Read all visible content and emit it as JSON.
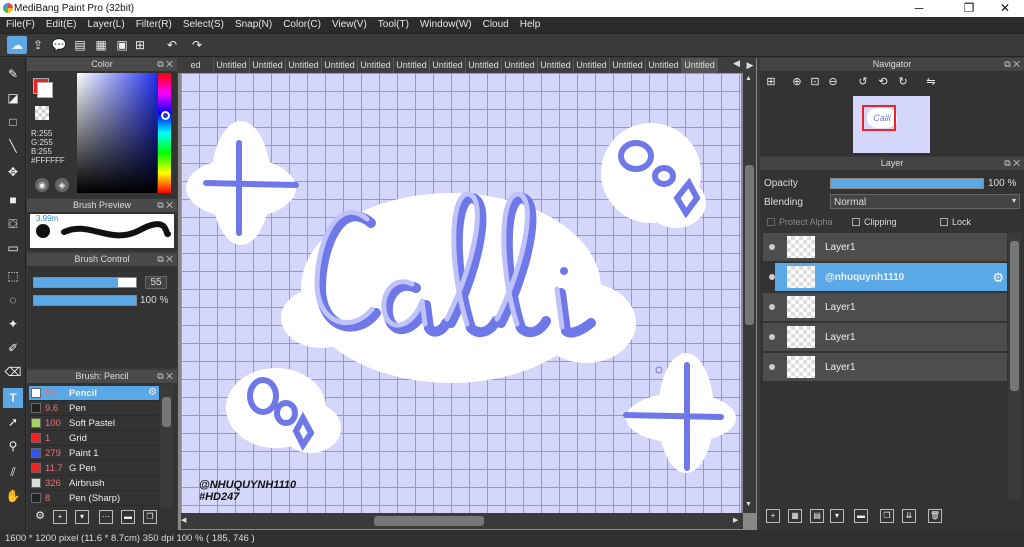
{
  "app": {
    "title": "MediBang Paint Pro (32bit)"
  },
  "window_controls": {
    "minimize": "─",
    "restore": "❐",
    "close": "✕"
  },
  "menu": [
    "File(F)",
    "Edit(E)",
    "Layer(L)",
    "Filter(R)",
    "Select(S)",
    "Snap(N)",
    "Color(C)",
    "View(V)",
    "Tool(T)",
    "Window(W)",
    "Cloud",
    "Help"
  ],
  "color_panel": {
    "title": "Color",
    "r": "R:255",
    "g": "G:255",
    "b": "B:255",
    "hex": "#FFFFFF",
    "primary": "#ffffff",
    "secondary": "#ee2222"
  },
  "brush_preview": {
    "title": "Brush Preview",
    "size": "3.99m"
  },
  "brush_control": {
    "title": "Brush Control",
    "size_value": "55",
    "opacity_value": "100 %",
    "size_fraction": 0.82,
    "opacity_fraction": 1.0
  },
  "brush_list": {
    "title": "Brush: Pencil",
    "items": [
      {
        "size": "55",
        "name": "Pencil",
        "color": "#ffffff",
        "selected": true
      },
      {
        "size": "9.6",
        "name": "Pen",
        "color": "#222222",
        "selected": false
      },
      {
        "size": "100",
        "name": "Soft Pastel",
        "color": "#a4d65e",
        "selected": false
      },
      {
        "size": "1",
        "name": "Grid",
        "color": "#ee2222",
        "selected": false
      },
      {
        "size": "279",
        "name": "Paint 1",
        "color": "#3355ee",
        "selected": false
      },
      {
        "size": "11.7",
        "name": "G Pen",
        "color": "#ee2222",
        "selected": false
      },
      {
        "size": "326",
        "name": "Airbrush",
        "color": "#dddddd",
        "selected": false
      },
      {
        "size": "8",
        "name": "Pen (Sharp)",
        "color": "#222222",
        "selected": false
      }
    ]
  },
  "canvas": {
    "tabs": [
      "ed",
      "Untitled",
      "Untitled",
      "Untitled",
      "Untitled",
      "Untitled",
      "Untitled",
      "Untitled",
      "Untitled",
      "Untitled",
      "Untitled",
      "Untitled",
      "Untitled",
      "Untitled",
      "Untitled"
    ],
    "art_text": "Calli",
    "signature_1": "@NHUQUYNH1110",
    "signature_2": "#HD247"
  },
  "navigator": {
    "title": "Navigator"
  },
  "layer_panel": {
    "title": "Layer",
    "opacity_label": "Opacity",
    "opacity_value": "100 %",
    "opacity_fraction": 1.0,
    "blending_label": "Blending",
    "blending_value": "Normal",
    "protect_alpha": "Protect Alpha",
    "clipping": "Clipping",
    "lock": "Lock",
    "layers": [
      {
        "name": "Layer1",
        "selected": false
      },
      {
        "name": "@nhuquynh1110",
        "selected": true
      },
      {
        "name": "Layer1",
        "selected": false
      },
      {
        "name": "Layer1",
        "selected": false
      },
      {
        "name": "Layer1",
        "selected": false
      }
    ]
  },
  "status": {
    "text": "1600 * 1200 pixel   (11.6 * 8.7cm)   350 dpi   100 %   ( 185, 746 )"
  },
  "colors": {
    "accent": "#5ba8e6",
    "canvas_bg": "#d4d6fb",
    "grid": "#8f95ee",
    "ink": "#6f78e8"
  }
}
